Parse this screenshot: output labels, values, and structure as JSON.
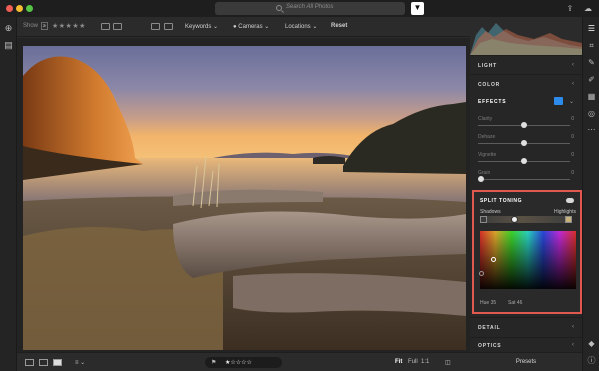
{
  "search": {
    "placeholder": "Search All Photos"
  },
  "filterbar": {
    "show_label": "Show",
    "show_count": "≥",
    "keywords": "Keywords",
    "cameras": "Cameras",
    "locations": "Locations",
    "reset": "Reset"
  },
  "panels": {
    "light": "LIGHT",
    "color": "COLOR",
    "effects": "EFFECTS",
    "detail": "DETAIL",
    "optics": "OPTICS",
    "presets": "Presets"
  },
  "effects": {
    "clarity": {
      "label": "Clarity",
      "value": "0"
    },
    "dehaze": {
      "label": "Dehaze",
      "value": "0"
    },
    "vignette": {
      "label": "Vignette",
      "value": "0"
    },
    "grain": {
      "label": "Grain",
      "value": "0"
    }
  },
  "split_toning": {
    "title": "SPLIT TONING",
    "shadows": "Shadows",
    "highlights": "Highlights",
    "hue_label": "Hue",
    "hue_value": "35",
    "sat_label": "Sat",
    "sat_value": "46"
  },
  "bottombar": {
    "fit": "Fit",
    "full": "Full",
    "ratio": "1:1"
  },
  "colors": {
    "accent_blue": "#2d8ceb",
    "highlight_border": "#e0584e",
    "panel_bg": "#262626"
  },
  "icons": {
    "left_rail": [
      "add-photos-icon",
      "library-icon"
    ],
    "right_rail": [
      "sliders-icon",
      "crop-icon",
      "healing-icon",
      "brush-icon",
      "gradient-icon",
      "radial-icon",
      "more-icon",
      "tag-icon",
      "info-icon"
    ]
  }
}
